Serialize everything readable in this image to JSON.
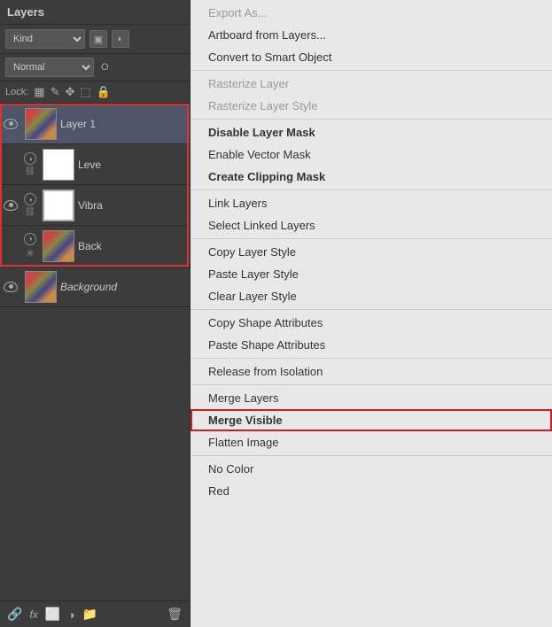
{
  "panel": {
    "title": "Layers",
    "kind_label": "Kind",
    "blend_mode": "Normal",
    "opacity_label": "O",
    "lock_label": "Lock:",
    "layers": [
      {
        "name": "Layer 1",
        "visible": true,
        "has_extras": false,
        "thumb_type": "image",
        "italic": false
      },
      {
        "name": "Leve",
        "visible": false,
        "has_extras": true,
        "thumb_type": "white",
        "italic": false
      },
      {
        "name": "Vibra",
        "visible": true,
        "has_extras": true,
        "thumb_type": "white_border",
        "italic": false
      },
      {
        "name": "Back",
        "visible": false,
        "has_extras": true,
        "thumb_type": "image",
        "italic": false
      },
      {
        "name": "Background",
        "visible": true,
        "has_extras": false,
        "thumb_type": "image",
        "italic": true
      }
    ]
  },
  "context_menu": {
    "sections": [
      {
        "items": [
          {
            "label": "Export As...",
            "bold": false,
            "disabled": true
          },
          {
            "label": "Artboard from Layers...",
            "bold": false,
            "disabled": false
          },
          {
            "label": "Convert to Smart Object",
            "bold": false,
            "disabled": false
          }
        ]
      },
      {
        "items": [
          {
            "label": "Rasterize Layer",
            "bold": false,
            "disabled": true
          },
          {
            "label": "Rasterize Layer Style",
            "bold": false,
            "disabled": true
          }
        ]
      },
      {
        "items": [
          {
            "label": "Disable Layer Mask",
            "bold": true,
            "disabled": false
          },
          {
            "label": "Enable Vector Mask",
            "bold": false,
            "disabled": false
          },
          {
            "label": "Create Clipping Mask",
            "bold": true,
            "disabled": false
          }
        ]
      },
      {
        "items": [
          {
            "label": "Link Layers",
            "bold": false,
            "disabled": false
          },
          {
            "label": "Select Linked Layers",
            "bold": false,
            "disabled": false
          }
        ]
      },
      {
        "items": [
          {
            "label": "Copy Layer Style",
            "bold": false,
            "disabled": false
          },
          {
            "label": "Paste Layer Style",
            "bold": false,
            "disabled": false
          },
          {
            "label": "Clear Layer Style",
            "bold": false,
            "disabled": false
          }
        ]
      },
      {
        "items": [
          {
            "label": "Copy Shape Attributes",
            "bold": false,
            "disabled": false
          },
          {
            "label": "Paste Shape Attributes",
            "bold": false,
            "disabled": false
          }
        ]
      },
      {
        "items": [
          {
            "label": "Release from Isolation",
            "bold": false,
            "disabled": false
          }
        ]
      },
      {
        "items": [
          {
            "label": "Merge Layers",
            "bold": false,
            "disabled": false
          },
          {
            "label": "Merge Visible",
            "bold": false,
            "disabled": false,
            "highlighted": true
          },
          {
            "label": "Flatten Image",
            "bold": false,
            "disabled": false
          }
        ]
      },
      {
        "items": [
          {
            "label": "No Color",
            "bold": false,
            "disabled": false
          },
          {
            "label": "Red",
            "bold": false,
            "disabled": false
          }
        ]
      }
    ]
  }
}
